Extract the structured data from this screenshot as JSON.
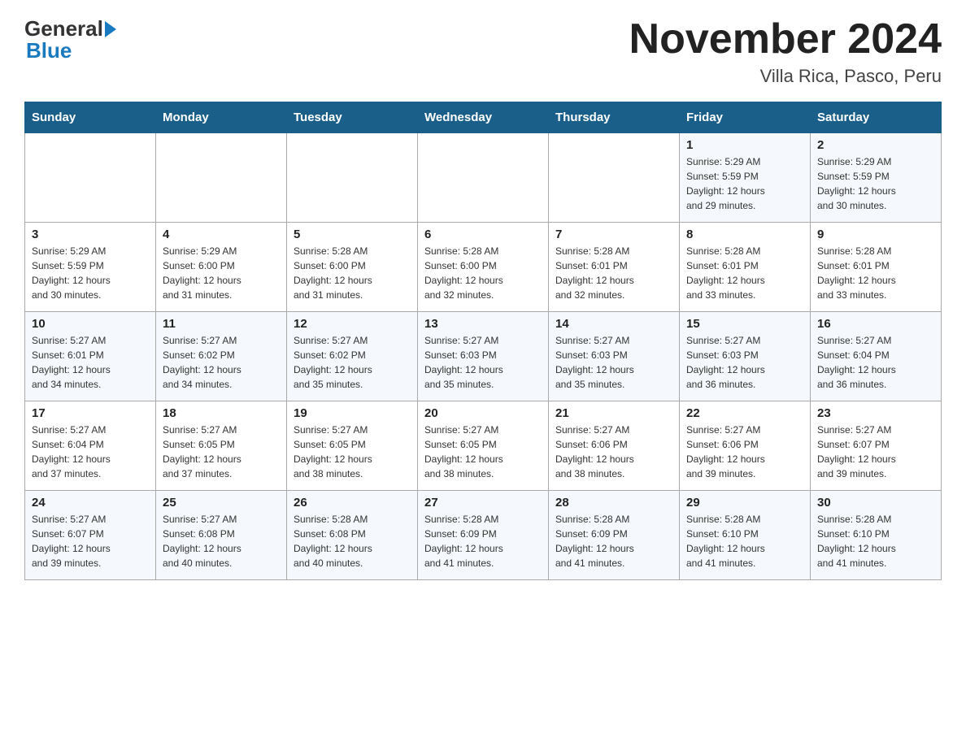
{
  "header": {
    "logo_general": "General",
    "logo_blue": "Blue",
    "month_title": "November 2024",
    "location": "Villa Rica, Pasco, Peru"
  },
  "days_of_week": [
    "Sunday",
    "Monday",
    "Tuesday",
    "Wednesday",
    "Thursday",
    "Friday",
    "Saturday"
  ],
  "weeks": [
    [
      {
        "day": "",
        "info": ""
      },
      {
        "day": "",
        "info": ""
      },
      {
        "day": "",
        "info": ""
      },
      {
        "day": "",
        "info": ""
      },
      {
        "day": "",
        "info": ""
      },
      {
        "day": "1",
        "info": "Sunrise: 5:29 AM\nSunset: 5:59 PM\nDaylight: 12 hours\nand 29 minutes."
      },
      {
        "day": "2",
        "info": "Sunrise: 5:29 AM\nSunset: 5:59 PM\nDaylight: 12 hours\nand 30 minutes."
      }
    ],
    [
      {
        "day": "3",
        "info": "Sunrise: 5:29 AM\nSunset: 5:59 PM\nDaylight: 12 hours\nand 30 minutes."
      },
      {
        "day": "4",
        "info": "Sunrise: 5:29 AM\nSunset: 6:00 PM\nDaylight: 12 hours\nand 31 minutes."
      },
      {
        "day": "5",
        "info": "Sunrise: 5:28 AM\nSunset: 6:00 PM\nDaylight: 12 hours\nand 31 minutes."
      },
      {
        "day": "6",
        "info": "Sunrise: 5:28 AM\nSunset: 6:00 PM\nDaylight: 12 hours\nand 32 minutes."
      },
      {
        "day": "7",
        "info": "Sunrise: 5:28 AM\nSunset: 6:01 PM\nDaylight: 12 hours\nand 32 minutes."
      },
      {
        "day": "8",
        "info": "Sunrise: 5:28 AM\nSunset: 6:01 PM\nDaylight: 12 hours\nand 33 minutes."
      },
      {
        "day": "9",
        "info": "Sunrise: 5:28 AM\nSunset: 6:01 PM\nDaylight: 12 hours\nand 33 minutes."
      }
    ],
    [
      {
        "day": "10",
        "info": "Sunrise: 5:27 AM\nSunset: 6:01 PM\nDaylight: 12 hours\nand 34 minutes."
      },
      {
        "day": "11",
        "info": "Sunrise: 5:27 AM\nSunset: 6:02 PM\nDaylight: 12 hours\nand 34 minutes."
      },
      {
        "day": "12",
        "info": "Sunrise: 5:27 AM\nSunset: 6:02 PM\nDaylight: 12 hours\nand 35 minutes."
      },
      {
        "day": "13",
        "info": "Sunrise: 5:27 AM\nSunset: 6:03 PM\nDaylight: 12 hours\nand 35 minutes."
      },
      {
        "day": "14",
        "info": "Sunrise: 5:27 AM\nSunset: 6:03 PM\nDaylight: 12 hours\nand 35 minutes."
      },
      {
        "day": "15",
        "info": "Sunrise: 5:27 AM\nSunset: 6:03 PM\nDaylight: 12 hours\nand 36 minutes."
      },
      {
        "day": "16",
        "info": "Sunrise: 5:27 AM\nSunset: 6:04 PM\nDaylight: 12 hours\nand 36 minutes."
      }
    ],
    [
      {
        "day": "17",
        "info": "Sunrise: 5:27 AM\nSunset: 6:04 PM\nDaylight: 12 hours\nand 37 minutes."
      },
      {
        "day": "18",
        "info": "Sunrise: 5:27 AM\nSunset: 6:05 PM\nDaylight: 12 hours\nand 37 minutes."
      },
      {
        "day": "19",
        "info": "Sunrise: 5:27 AM\nSunset: 6:05 PM\nDaylight: 12 hours\nand 38 minutes."
      },
      {
        "day": "20",
        "info": "Sunrise: 5:27 AM\nSunset: 6:05 PM\nDaylight: 12 hours\nand 38 minutes."
      },
      {
        "day": "21",
        "info": "Sunrise: 5:27 AM\nSunset: 6:06 PM\nDaylight: 12 hours\nand 38 minutes."
      },
      {
        "day": "22",
        "info": "Sunrise: 5:27 AM\nSunset: 6:06 PM\nDaylight: 12 hours\nand 39 minutes."
      },
      {
        "day": "23",
        "info": "Sunrise: 5:27 AM\nSunset: 6:07 PM\nDaylight: 12 hours\nand 39 minutes."
      }
    ],
    [
      {
        "day": "24",
        "info": "Sunrise: 5:27 AM\nSunset: 6:07 PM\nDaylight: 12 hours\nand 39 minutes."
      },
      {
        "day": "25",
        "info": "Sunrise: 5:27 AM\nSunset: 6:08 PM\nDaylight: 12 hours\nand 40 minutes."
      },
      {
        "day": "26",
        "info": "Sunrise: 5:28 AM\nSunset: 6:08 PM\nDaylight: 12 hours\nand 40 minutes."
      },
      {
        "day": "27",
        "info": "Sunrise: 5:28 AM\nSunset: 6:09 PM\nDaylight: 12 hours\nand 41 minutes."
      },
      {
        "day": "28",
        "info": "Sunrise: 5:28 AM\nSunset: 6:09 PM\nDaylight: 12 hours\nand 41 minutes."
      },
      {
        "day": "29",
        "info": "Sunrise: 5:28 AM\nSunset: 6:10 PM\nDaylight: 12 hours\nand 41 minutes."
      },
      {
        "day": "30",
        "info": "Sunrise: 5:28 AM\nSunset: 6:10 PM\nDaylight: 12 hours\nand 41 minutes."
      }
    ]
  ]
}
